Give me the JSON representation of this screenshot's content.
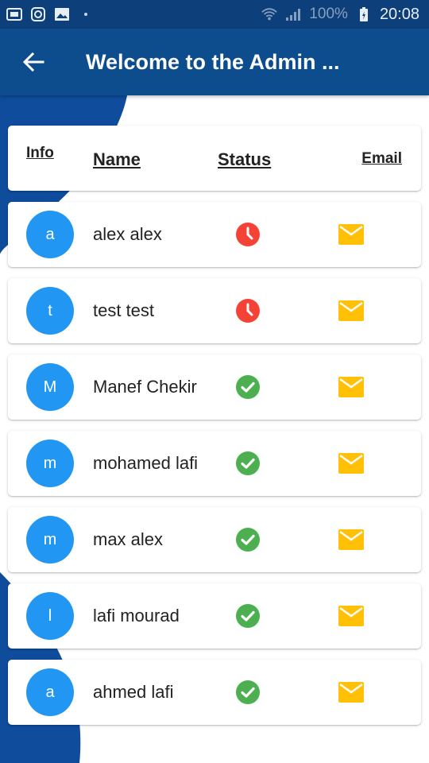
{
  "status_bar": {
    "battery": "100%",
    "time": "20:08"
  },
  "app_bar": {
    "title": "Welcome to the Admin ..."
  },
  "table_header": {
    "info": "Info",
    "name": "Name",
    "status": "Status",
    "email": "Email"
  },
  "users": [
    {
      "initial": "a",
      "name": "alex alex",
      "status": "pending"
    },
    {
      "initial": "t",
      "name": "test test",
      "status": "pending"
    },
    {
      "initial": "M",
      "name": "Manef Chekir",
      "status": "active"
    },
    {
      "initial": "m",
      "name": "mohamed lafi",
      "status": "active"
    },
    {
      "initial": "m",
      "name": "max alex",
      "status": "active"
    },
    {
      "initial": "l",
      "name": "lafi mourad",
      "status": "active"
    },
    {
      "initial": "a",
      "name": "ahmed lafi",
      "status": "active"
    }
  ],
  "colors": {
    "status_bar": "#0d3f7a",
    "app_bar": "#0d4d8e",
    "avatar": "#2196f3",
    "pending": "#f44336",
    "active": "#4caf50",
    "email": "#ffc107",
    "decoration": "#0f4c9c"
  },
  "icons": {
    "back": "arrow-left-icon",
    "pending": "clock-icon",
    "active": "check-circle-icon",
    "email": "mail-icon"
  }
}
